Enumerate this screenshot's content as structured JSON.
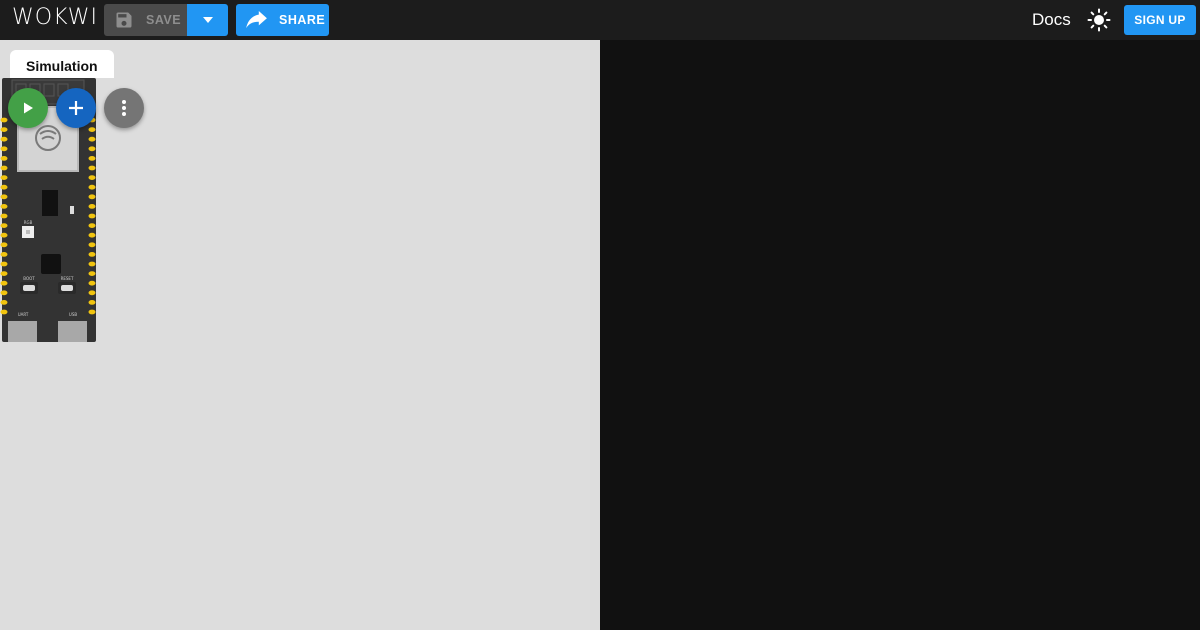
{
  "header": {
    "logo_text": "WOKWI",
    "save_label": "SAVE",
    "share_label": "SHARE",
    "docs_label": "Docs",
    "signup_label": "SIGN UP",
    "icons": {
      "save": "floppy-disk-icon",
      "dropdown": "chevron-down-icon",
      "share": "share-arrow-icon",
      "theme": "sun-icon"
    }
  },
  "simulation": {
    "tab_label": "Simulation",
    "buttons": {
      "play": "play-icon",
      "add": "plus-icon",
      "more": "more-vertical-icon"
    },
    "board": {
      "chip_label": "RGB",
      "boot_label": "BOOT",
      "reset_label": "RESET",
      "uart_label": "UART",
      "usb_label": "USB"
    }
  },
  "colors": {
    "primary": "#2196f3",
    "play": "#43a047",
    "add": "#1565c0",
    "more": "#757575",
    "pin": "#f1c40f"
  }
}
